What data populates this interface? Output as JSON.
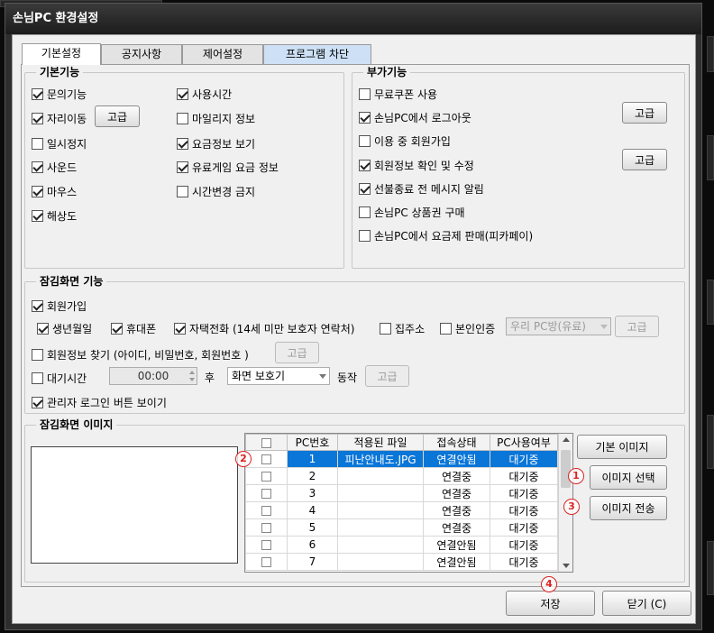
{
  "window": {
    "title": "손님PC 환경설정"
  },
  "tabs": [
    {
      "label": "기본설정",
      "active": true
    },
    {
      "label": "공지사항",
      "active": false
    },
    {
      "label": "제어설정",
      "active": false
    },
    {
      "label": "프로그램 차단",
      "active": false
    }
  ],
  "basic": {
    "title": "기본기능",
    "items": [
      {
        "label": "문의기능",
        "checked": true
      },
      {
        "label": "자리이동",
        "checked": true
      },
      {
        "label": "일시정지",
        "checked": false
      },
      {
        "label": "사운드",
        "checked": true
      },
      {
        "label": "마우스",
        "checked": true
      },
      {
        "label": "해상도",
        "checked": true
      },
      {
        "label": "사용시간",
        "checked": true
      },
      {
        "label": "마일리지 정보",
        "checked": false
      },
      {
        "label": "요금정보 보기",
        "checked": true
      },
      {
        "label": "유료게임 요금 정보",
        "checked": true
      },
      {
        "label": "시간변경 금지",
        "checked": false
      }
    ],
    "advanced_label": "고급"
  },
  "extra": {
    "title": "부가기능",
    "items": [
      {
        "label": "무료쿠폰 사용",
        "checked": false
      },
      {
        "label": "손님PC에서 로그아웃",
        "checked": true
      },
      {
        "label": "이용 중 회원가입",
        "checked": false
      },
      {
        "label": "회원정보 확인 및 수정",
        "checked": true
      },
      {
        "label": "선불종료 전 메시지 알림",
        "checked": true
      },
      {
        "label": "손님PC 상품권 구매",
        "checked": false
      },
      {
        "label": "손님PC에서 요금제 판매(피카페이)",
        "checked": false
      }
    ],
    "advanced_label_1": "고급",
    "advanced_label_2": "고급"
  },
  "lock": {
    "title": "잠김화면 기능",
    "signup": {
      "label": "회원가입",
      "checked": true
    },
    "sub": [
      {
        "label": "생년월일",
        "checked": true
      },
      {
        "label": "휴대폰",
        "checked": true
      },
      {
        "label": "자택전화 (14세 미만 보호자 연락처)",
        "checked": true
      },
      {
        "label": "집주소",
        "checked": false
      },
      {
        "label": "본인인증",
        "checked": false
      }
    ],
    "cert_select": "우리 PC방(유료)",
    "advanced_label": "고급",
    "find": {
      "label": "회원정보 찾기 (아이디, 비밀번호, 회원번호 )",
      "checked": false
    },
    "idle": {
      "label": "대기시간",
      "checked": false
    },
    "idle_time": "00:00",
    "after_label": "후",
    "action_select": "화면 보호기",
    "action_label": "동작",
    "admin_login": {
      "label": "관리자 로그인 버튼 보이기",
      "checked": true
    }
  },
  "image": {
    "title": "잠김화면 이미지",
    "columns": [
      "PC번호",
      "적용된 파일",
      "접속상태",
      "PC사용여부"
    ],
    "rows": [
      {
        "pc": "1",
        "file": "피난안내도.JPG",
        "status": "연결안됨",
        "use": "대기중"
      },
      {
        "pc": "2",
        "file": "",
        "status": "연결중",
        "use": "대기중"
      },
      {
        "pc": "3",
        "file": "",
        "status": "연결중",
        "use": "대기중"
      },
      {
        "pc": "4",
        "file": "",
        "status": "연결중",
        "use": "대기중"
      },
      {
        "pc": "5",
        "file": "",
        "status": "연결중",
        "use": "대기중"
      },
      {
        "pc": "6",
        "file": "",
        "status": "연결안됨",
        "use": "대기중"
      },
      {
        "pc": "7",
        "file": "",
        "status": "연결안됨",
        "use": "대기중"
      }
    ],
    "buttons": {
      "default": "기본 이미지",
      "select": "이미지 선택",
      "send": "이미지 전송"
    }
  },
  "markers": {
    "m1": "1",
    "m2": "2",
    "m3": "3",
    "m4": "4"
  },
  "footer": {
    "save": "저장",
    "close": "닫기 (C)"
  },
  "colors": {
    "selection": "#0a76d8",
    "marker": "#dd2222"
  }
}
